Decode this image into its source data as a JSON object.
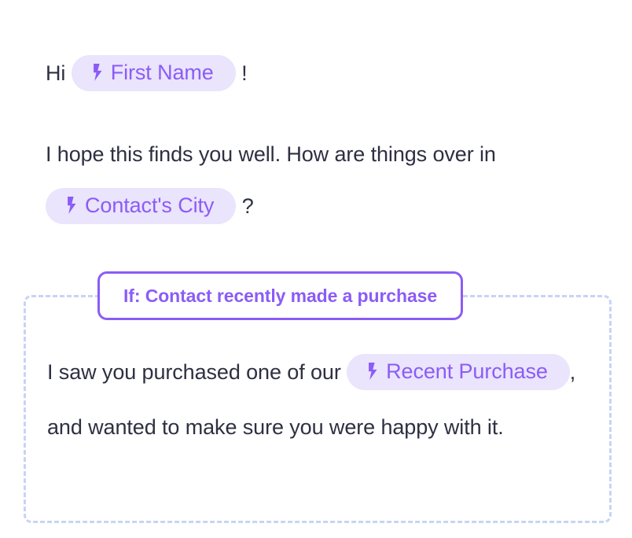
{
  "page": {
    "background": "#ffffff",
    "text_color": "#2E3042",
    "accent_purple": "#8B5CF6",
    "chip_background": "#EAE4FC",
    "dashed_border_color": "#C8D4F5"
  },
  "greeting": {
    "before": "Hi ",
    "token_label": "First Name",
    "token_icon": "lightning-bolt-icon",
    "after": " !"
  },
  "intro": {
    "before": "I hope this finds you well. How are things over in ",
    "token_label": "Contact's City",
    "token_icon": "lightning-bolt-icon",
    "after": " ?"
  },
  "conditional": {
    "header_label": "If: Contact recently made a purchase",
    "body_before": "I saw you purchased one of our ",
    "token_label": "Recent Purchase",
    "token_icon": "lightning-bolt-icon",
    "body_after": ", and wanted to make sure you were happy with it."
  }
}
